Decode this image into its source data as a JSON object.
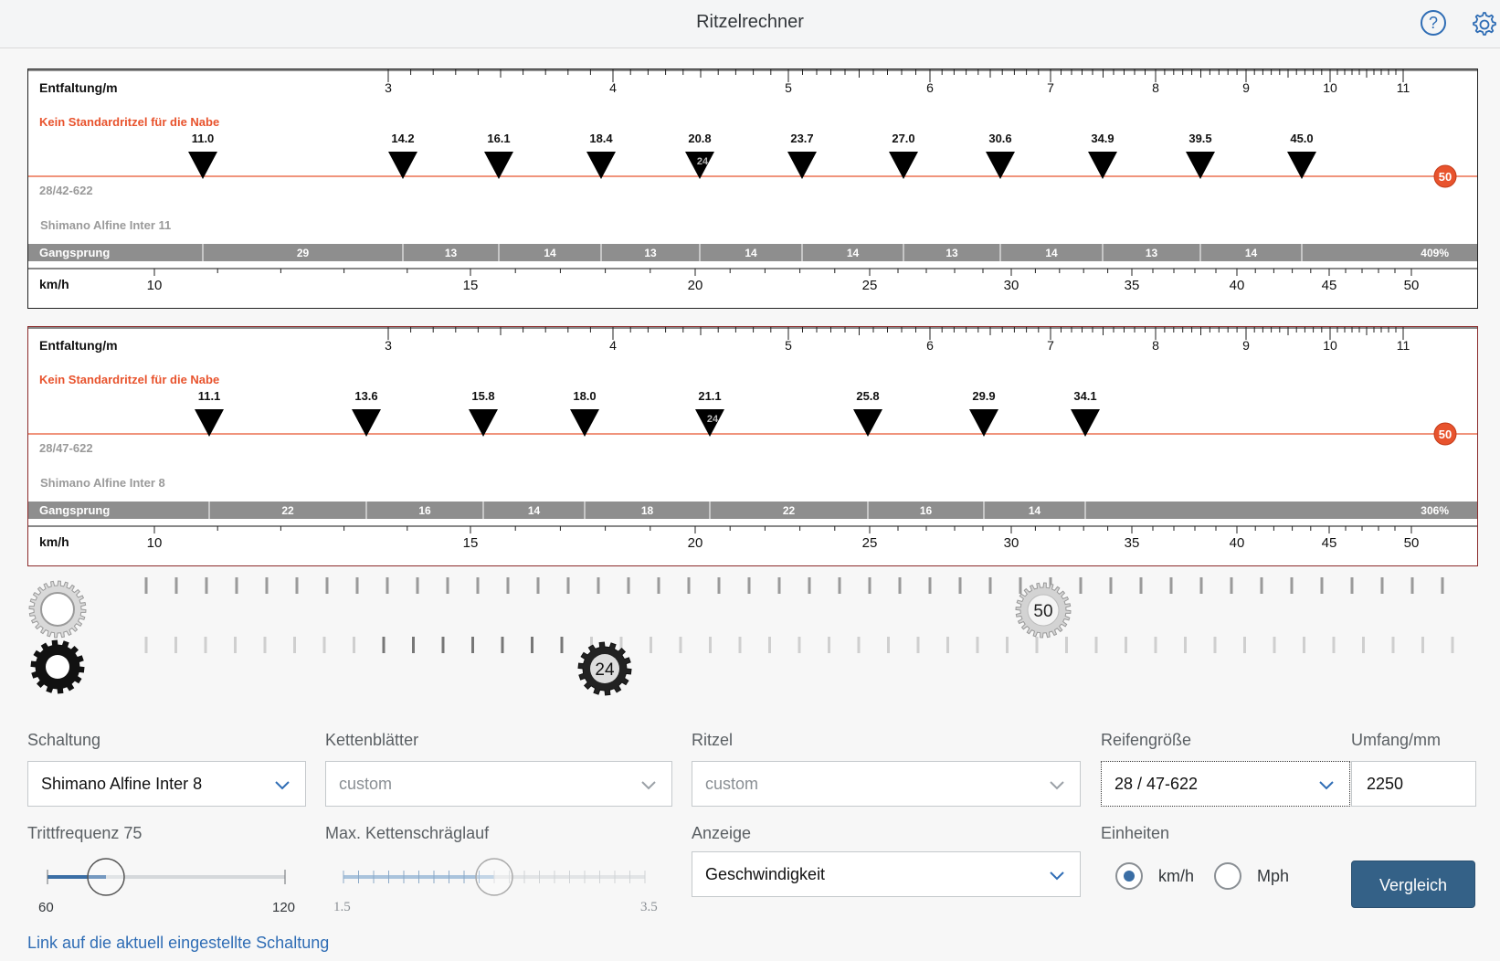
{
  "app": {
    "title": "Ritzelrechner"
  },
  "header": {
    "help_icon": "question-circle-icon",
    "settings_icon": "gear-icon"
  },
  "charts": [
    {
      "entfaltung_label": "Entfaltung/m",
      "entfaltung_ticks": [
        "3",
        "4",
        "5",
        "6",
        "7",
        "8",
        "9",
        "10",
        "11"
      ],
      "warning": "Kein Standardritzel für die Nabe",
      "tyre": "28/42-622",
      "hub": "Shimano Alfine Inter 11",
      "gears": [
        "11.0",
        "14.2",
        "16.1",
        "18.4",
        "20.8",
        "23.7",
        "27.0",
        "30.6",
        "34.9",
        "39.5",
        "45.0"
      ],
      "sprocket_marker": "24",
      "chainring_marker": "50",
      "gangsprung_label": "Gangsprung",
      "gangsprung": [
        "29",
        "13",
        "14",
        "13",
        "14",
        "14",
        "13",
        "14",
        "13",
        "14"
      ],
      "gangsprung_total": "409%",
      "speed_label": "km/h",
      "speed_ticks": [
        "10",
        "15",
        "20",
        "25",
        "30",
        "35",
        "40",
        "45",
        "50"
      ]
    },
    {
      "entfaltung_label": "Entfaltung/m",
      "entfaltung_ticks": [
        "3",
        "4",
        "5",
        "6",
        "7",
        "8",
        "9",
        "10",
        "11"
      ],
      "warning": "Kein Standardritzel für die Nabe",
      "tyre": "28/47-622",
      "hub": "Shimano Alfine Inter 8",
      "gears": [
        "11.1",
        "13.6",
        "15.8",
        "18.0",
        "21.1",
        "25.8",
        "29.9",
        "34.1"
      ],
      "sprocket_marker": "24",
      "chainring_marker": "50",
      "gangsprung_label": "Gangsprung",
      "gangsprung": [
        "22",
        "16",
        "14",
        "18",
        "22",
        "16",
        "14"
      ],
      "gangsprung_total": "306%",
      "speed_label": "km/h",
      "speed_ticks": [
        "10",
        "15",
        "20",
        "25",
        "30",
        "35",
        "40",
        "45",
        "50"
      ]
    }
  ],
  "cogs": {
    "chainring_selected": "50",
    "sprocket_selected": "24"
  },
  "form": {
    "schaltung": {
      "label": "Schaltung",
      "value": "Shimano Alfine Inter 8"
    },
    "kettenblaetter": {
      "label": "Kettenblätter",
      "value": "custom"
    },
    "ritzel": {
      "label": "Ritzel",
      "value": "custom"
    },
    "reifengroesse": {
      "label": "Reifengröße",
      "value": "28 / 47-622"
    },
    "umfang": {
      "label": "Umfang/mm",
      "value": "2250"
    },
    "trittfrequenz": {
      "label": "Trittfrequenz 75",
      "min": "60",
      "max": "120",
      "value": 75
    },
    "kettenschraeglauf": {
      "label": "Max. Kettenschräglauf",
      "min": "1.5",
      "max": "3.5",
      "value": 2.5
    },
    "anzeige": {
      "label": "Anzeige",
      "value": "Geschwindigkeit"
    },
    "einheiten": {
      "label": "Einheiten",
      "options": [
        "km/h",
        "Mph"
      ],
      "selected": "km/h"
    },
    "compare_button": "Vergleich"
  },
  "link_text": "Link auf die aktuell eingestellte Schaltung",
  "colors": {
    "accent": "#346187",
    "chainline": "#e8532d",
    "bar": "#8e8e8e"
  }
}
